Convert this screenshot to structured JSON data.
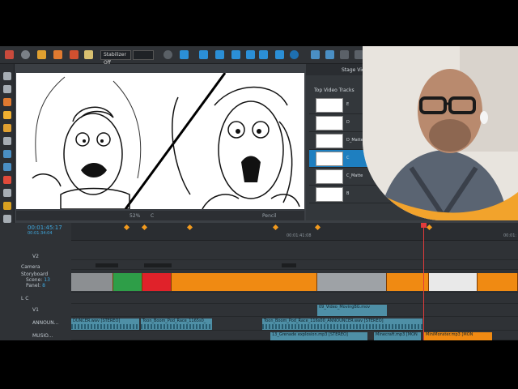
{
  "toolbar": {
    "stabilizer": "Stabilizer Off",
    "stage_view": "Stage View"
  },
  "canvas_bar": {
    "zoom": "52%",
    "extra": "C",
    "tool": "Pencil"
  },
  "stage": {
    "title": "Top Video Tracks",
    "tracks": [
      {
        "label": "E"
      },
      {
        "label": "D"
      },
      {
        "label": "D_Matte"
      },
      {
        "label": "C",
        "selected": true
      },
      {
        "label": "C_Matte"
      },
      {
        "label": "B"
      }
    ]
  },
  "timeline": {
    "timecode_main": "00:01:45:17",
    "timecode_sub": "00:01:34:04",
    "ruler_mid": "00:01:41:08",
    "ruler_right": "00:01:",
    "tracks": {
      "v2": "V2",
      "camera": "Camera",
      "storyboard": "Storyboard",
      "scene_label": "Scene:",
      "scene_value": "13",
      "panel_label": "Panel:",
      "panel_value": "8",
      "lc": "L C",
      "v1": "V1",
      "announcer": "ANNOUN...",
      "music": "MUSIO..."
    },
    "clips": {
      "video1": "09_Video_MovingBG.mov",
      "audio_a": "DUNCER.wav [STEREO]",
      "audio_b": "Toon_Boom_Pod_Race_1165s0_",
      "audio_c": "Toon_Boom_Pod_Race_116s00_ANNOUNCER.wav [STEREO]",
      "audio_d": "13_Grenade explosion.mp3 [STEREO]",
      "audio_e": "Minecraft.mp3 [MON",
      "audio_f": "MiniMonster.mp3 [MON"
    }
  },
  "colors": {
    "accent": "#1e7fc0",
    "panel_orange": "#f08a12",
    "playhead": "#e23b3b"
  }
}
